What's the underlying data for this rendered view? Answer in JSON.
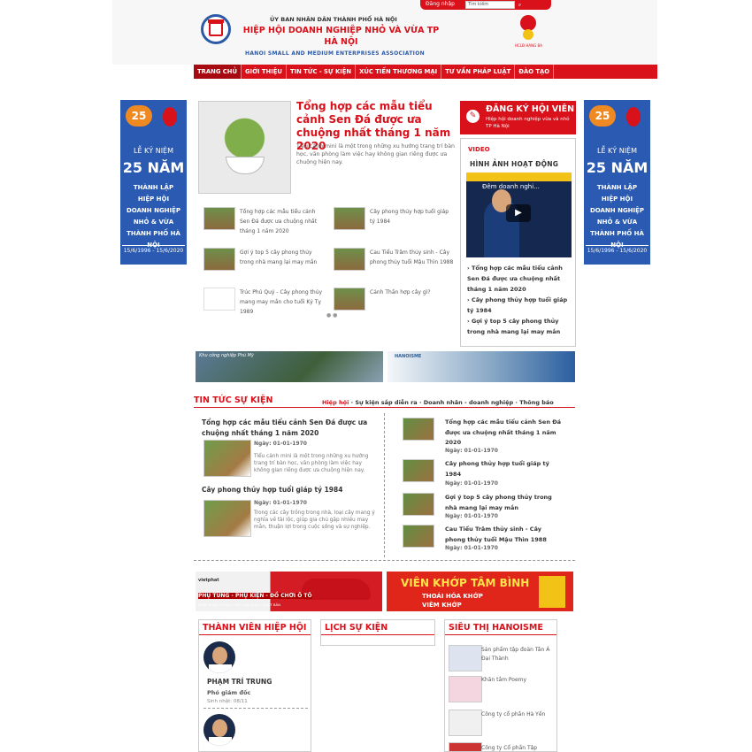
{
  "header": {
    "login": "Đăng nhập",
    "search_placeholder": "Tìm kiếm",
    "subtitle": "ỦY BAN NHÂN DÂN THÀNH PHỐ HÀ NỘI",
    "title": "HIỆP HỘI DOANH NGHIỆP NHỎ VÀ VỪA TP HÀ NỘI",
    "english": "HANOI SMALL AND MEDIUM ENTERPRISES ASSOCIATION",
    "medal_caption": "HCLĐ HẠNG BA"
  },
  "nav": [
    "TRANG CHỦ",
    "GIỚI THIỆU",
    "TIN TỨC - SỰ KIỆN",
    "XÚC TIẾN THƯƠNG MẠI",
    "TƯ VẤN PHÁP LUẬT",
    "ĐÀO TẠO"
  ],
  "banner": {
    "badge": "25",
    "line1": "LỄ KỶ NIỆM",
    "line2": "25 NĂM",
    "line3a": "THÀNH LẬP",
    "line3b": "HIỆP HỘI",
    "line3c": "DOANH NGHIỆP",
    "line3d": "NHỎ & VỪA",
    "line3e": "THÀNH PHỐ HÀ NỘI",
    "dates": "15/6/1996 - 15/6/2020"
  },
  "featured": {
    "title": "Tổng hợp các mẫu tiểu cảnh Sen Đá được ưa chuộng nhất tháng 1 năm 2020",
    "desc": "Tiểu cảnh mini là một trong những xu hướng trang trí bàn học, văn phòng làm việc hay không gian riêng được ưa chuộng hiện nay."
  },
  "related": [
    "Tổng hợp các mẫu tiểu cảnh Sen Đá được ưa chuộng nhất tháng 1 năm 2020",
    "Cây phong thủy hợp tuổi giáp tý 1984",
    "Gợi ý top 5 cây phong thủy trong nhà mang lại may mắn",
    "Cau Tiểu Trâm thủy sinh - Cây phong thủy tuổi Mậu Thìn 1988",
    "Trúc Phú Quý - Cây phong thủy mang may mắn cho tuổi Kỷ Tỵ 1989",
    "Cảnh Thần hợp cây gì?"
  ],
  "register": {
    "title": "ĐĂNG KÝ HỘI VIÊN",
    "desc": "Hiệp hội doanh nghiệp vừa và nhỏ TP Hà Nội"
  },
  "video": {
    "label": "VIDEO",
    "title": "HÌNH ẢNH HOẠT ĐỘNG",
    "caption": "Đêm doanh nghi...",
    "links": [
      "Tổng hợp các mẫu tiểu cảnh Sen Đá được ưa chuộng nhất tháng 1 năm 2020",
      "Cây phong thủy hợp tuổi giáp tý 1984",
      "Gợi ý top 5 cây phong thủy trong nhà mang lại may mắn"
    ]
  },
  "ads_top": {
    "left": "Khu công nghiệp Phú Mỹ",
    "right": "HANOISME"
  },
  "news": {
    "heading": "TIN TỨC SỰ KIỆN",
    "tabs": [
      "Hiệp hội",
      "Sự kiện sắp diễn ra",
      "Doanh nhân - doanh nghiệp",
      "Thông báo"
    ],
    "left": [
      {
        "title": "Tổng hợp các mẫu tiểu cảnh Sen Đá được ưa chuộng nhất tháng 1 năm 2020",
        "date": "Ngày: 01-01-1970",
        "desc": "Tiểu cảnh mini là một trong những xu hướng trang trí bàn học, văn phòng làm việc hay không gian riêng được ưa chuộng hiện nay."
      },
      {
        "title": "Cây phong thủy hợp tuổi giáp tý 1984",
        "date": "Ngày: 01-01-1970",
        "desc": "Trong các cây trồng trong nhà, loại cây mang ý nghĩa về tài lộc, giúp gia chủ gặp nhiều may mắn, thuận lợi trong cuộc sống và sự nghiệp."
      }
    ],
    "right": [
      {
        "title": "Tổng hợp các mẫu tiểu cảnh Sen Đá được ưa chuộng nhất tháng 1 năm 2020",
        "date": "Ngày: 01-01-1970"
      },
      {
        "title": "Cây phong thủy hợp tuổi giáp tý 1984",
        "date": "Ngày: 01-01-1970"
      },
      {
        "title": "Gợi ý top 5 cây phong thủy trong nhà mang lại may mắn",
        "date": "Ngày: 01-01-1970"
      },
      {
        "title": "Cau Tiểu Trâm thủy sinh - Cây phong thủy tuổi Mậu Thìn 1988",
        "date": "Ngày: 01-01-1970"
      }
    ]
  },
  "ads_mid": {
    "left_brand": "vietphat",
    "left_text": "PHỤ TÙNG - PHỤ KIỆN - ĐỒ CHƠI Ô TÔ",
    "left_sub": "NHẬP KHẨU TỪ ĐỨC, MỸ, HÀN QUỐC, NHẬT BẢN",
    "right_title": "VIÊN KHỚP TÂM BÌNH",
    "right_line1": "THOÁI HÓA KHỚP",
    "right_line2": "VIÊM KHỚP"
  },
  "members": {
    "heading": "THÀNH VIÊN HIỆP HỘI",
    "name": "PHẠM TRÍ TRUNG",
    "position": "Phó giám đốc",
    "birth": "Sinh nhật: 08/11"
  },
  "history": {
    "heading": "LỊCH SỰ KIỆN"
  },
  "market": {
    "heading": "SIÊU THỊ HANOISME",
    "items": [
      "Sản phẩm tập đoàn Tân Á Đại Thành",
      "Khăn tắm Poemy",
      "Công ty cổ phần Hà Yến",
      "Công ty Cổ phần Tập"
    ]
  }
}
